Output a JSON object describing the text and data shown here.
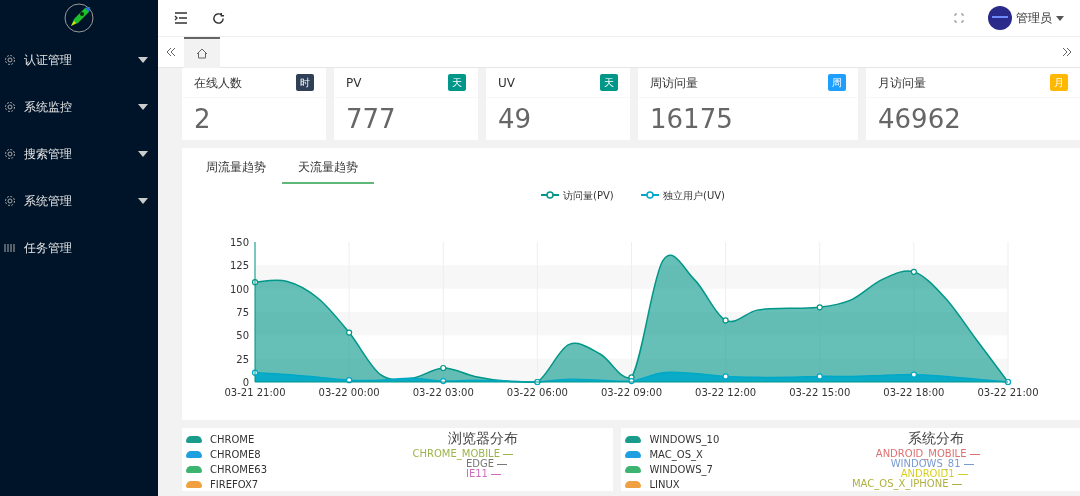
{
  "sidebar": {
    "items": [
      {
        "label": "认证管理",
        "kind": "group"
      },
      {
        "label": "系统监控",
        "kind": "group"
      },
      {
        "label": "搜索管理",
        "kind": "group"
      },
      {
        "label": "系统管理",
        "kind": "group"
      },
      {
        "label": "任务管理",
        "kind": "link"
      }
    ]
  },
  "header": {
    "user": "管理员"
  },
  "tabs": [
    {
      "selected": true
    }
  ],
  "stats": [
    {
      "title": "在线人数",
      "badge": "时",
      "color": "#2f4056",
      "value": "2"
    },
    {
      "title": "PV",
      "badge": "天",
      "color": "#009688",
      "value": "777"
    },
    {
      "title": "UV",
      "badge": "天",
      "color": "#009688",
      "value": "49"
    },
    {
      "title": "周访问量",
      "badge": "周",
      "color": "#1e9fff",
      "value": "16175"
    },
    {
      "title": "月访问量",
      "badge": "月",
      "color": "#ffb800",
      "value": "46962"
    }
  ],
  "trend": {
    "tabs": [
      {
        "label": "周流量趋势",
        "selected": false
      },
      {
        "label": "天流量趋势",
        "selected": true
      }
    ],
    "chart_data": {
      "type": "area",
      "categories": [
        "03-21 21:00",
        null,
        null,
        "03-22 00:00",
        null,
        null,
        "03-22 03:00",
        null,
        null,
        "03-22 06:00",
        null,
        null,
        "03-22 09:00",
        null,
        null,
        "03-22 12:00",
        null,
        null,
        "03-22 15:00",
        null,
        null,
        "03-22 18:00",
        null,
        null,
        "03-22 21:00"
      ],
      "series": [
        {
          "name": "访问量(PV)",
          "color": "#009688",
          "values": [
            107,
            108,
            90,
            53,
            8,
            4,
            15,
            6,
            1,
            0,
            40,
            30,
            5,
            130,
            110,
            66,
            77,
            79,
            80,
            88,
            110,
            118,
            90,
            45,
            0
          ]
        },
        {
          "name": "独立用户(UV)",
          "color": "#00a8c8",
          "values": [
            10,
            8,
            5,
            2,
            2,
            4,
            1,
            2,
            1,
            0,
            3,
            2,
            1,
            10,
            9,
            6,
            5,
            5,
            6,
            6,
            7,
            8,
            6,
            3,
            0
          ]
        }
      ],
      "ylim": [
        0,
        150
      ],
      "yticks": [
        0,
        25,
        50,
        75,
        100,
        125,
        150
      ],
      "grid": true,
      "legend": "top"
    }
  },
  "distributions": [
    {
      "title": "浏览器分布",
      "legend": [
        {
          "label": "CHROME",
          "color": "#1a9b8c"
        },
        {
          "label": "CHROME8",
          "color": "#1e9fe0"
        },
        {
          "label": "CHROME63",
          "color": "#3cb371"
        },
        {
          "label": "FIREFOX7",
          "color": "#f0a040"
        }
      ],
      "labels": [
        {
          "label": "CHROME_MOBILE",
          "color": "#9bb54a"
        },
        {
          "label": "EDGE",
          "color": "#777777"
        },
        {
          "label": "IE11",
          "color": "#d06bc0"
        }
      ]
    },
    {
      "title": "系统分布",
      "legend": [
        {
          "label": "WINDOWS_10",
          "color": "#1a9b8c"
        },
        {
          "label": "MAC_OS_X",
          "color": "#1e9fe0"
        },
        {
          "label": "WINDOWS_7",
          "color": "#3cb371"
        },
        {
          "label": "LINUX",
          "color": "#f0a040"
        }
      ],
      "labels": [
        {
          "label": "ANDROID_MOBILE",
          "color": "#e07070"
        },
        {
          "label": "WINDOWS_81",
          "color": "#7a9ad0"
        },
        {
          "label": "ANDROID1",
          "color": "#d8d020"
        },
        {
          "label": "MAC_OS_X_IPHONE",
          "color": "#b0b040"
        }
      ]
    }
  ]
}
